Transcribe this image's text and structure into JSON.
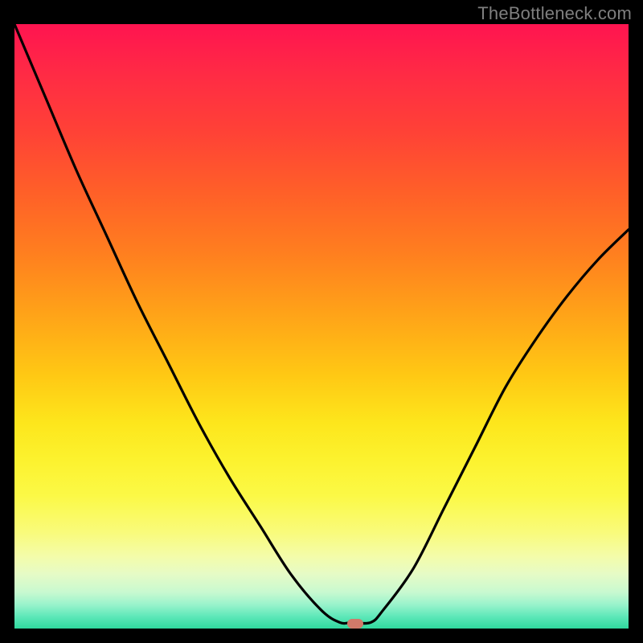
{
  "watermark": "TheBottleneck.com",
  "marker": {
    "x_frac": 0.555,
    "y_frac": 0.992,
    "color": "#d07a6a"
  },
  "gradient_stops": [
    {
      "pct": 0,
      "color": "#ff1450"
    },
    {
      "pct": 8,
      "color": "#ff2a45"
    },
    {
      "pct": 18,
      "color": "#ff4236"
    },
    {
      "pct": 28,
      "color": "#ff6028"
    },
    {
      "pct": 38,
      "color": "#ff7f1f"
    },
    {
      "pct": 48,
      "color": "#ffa318"
    },
    {
      "pct": 58,
      "color": "#ffc814"
    },
    {
      "pct": 66,
      "color": "#fde61c"
    },
    {
      "pct": 72,
      "color": "#fcf22e"
    },
    {
      "pct": 78,
      "color": "#fbf946"
    },
    {
      "pct": 84,
      "color": "#f9fb7a"
    },
    {
      "pct": 88,
      "color": "#f4fca9"
    },
    {
      "pct": 91,
      "color": "#e6fbc6"
    },
    {
      "pct": 94,
      "color": "#c8f9d0"
    },
    {
      "pct": 96,
      "color": "#9af3cc"
    },
    {
      "pct": 98,
      "color": "#5ee8b9"
    },
    {
      "pct": 100,
      "color": "#2fd99e"
    }
  ],
  "chart_data": {
    "type": "line",
    "title": "",
    "xlabel": "",
    "ylabel": "",
    "xlim": [
      0,
      100
    ],
    "ylim": [
      0,
      100
    ],
    "series": [
      {
        "name": "bottleneck-curve",
        "x": [
          0,
          5,
          10,
          15,
          20,
          25,
          30,
          35,
          40,
          45,
          50,
          53,
          55,
          58,
          60,
          65,
          70,
          75,
          80,
          85,
          90,
          95,
          100
        ],
        "y": [
          100,
          88,
          76,
          65,
          54,
          44,
          34,
          25,
          17,
          9,
          3,
          1,
          1,
          1,
          3,
          10,
          20,
          30,
          40,
          48,
          55,
          61,
          66
        ]
      }
    ],
    "marker_point": {
      "x": 55.5,
      "y": 0.8
    }
  }
}
